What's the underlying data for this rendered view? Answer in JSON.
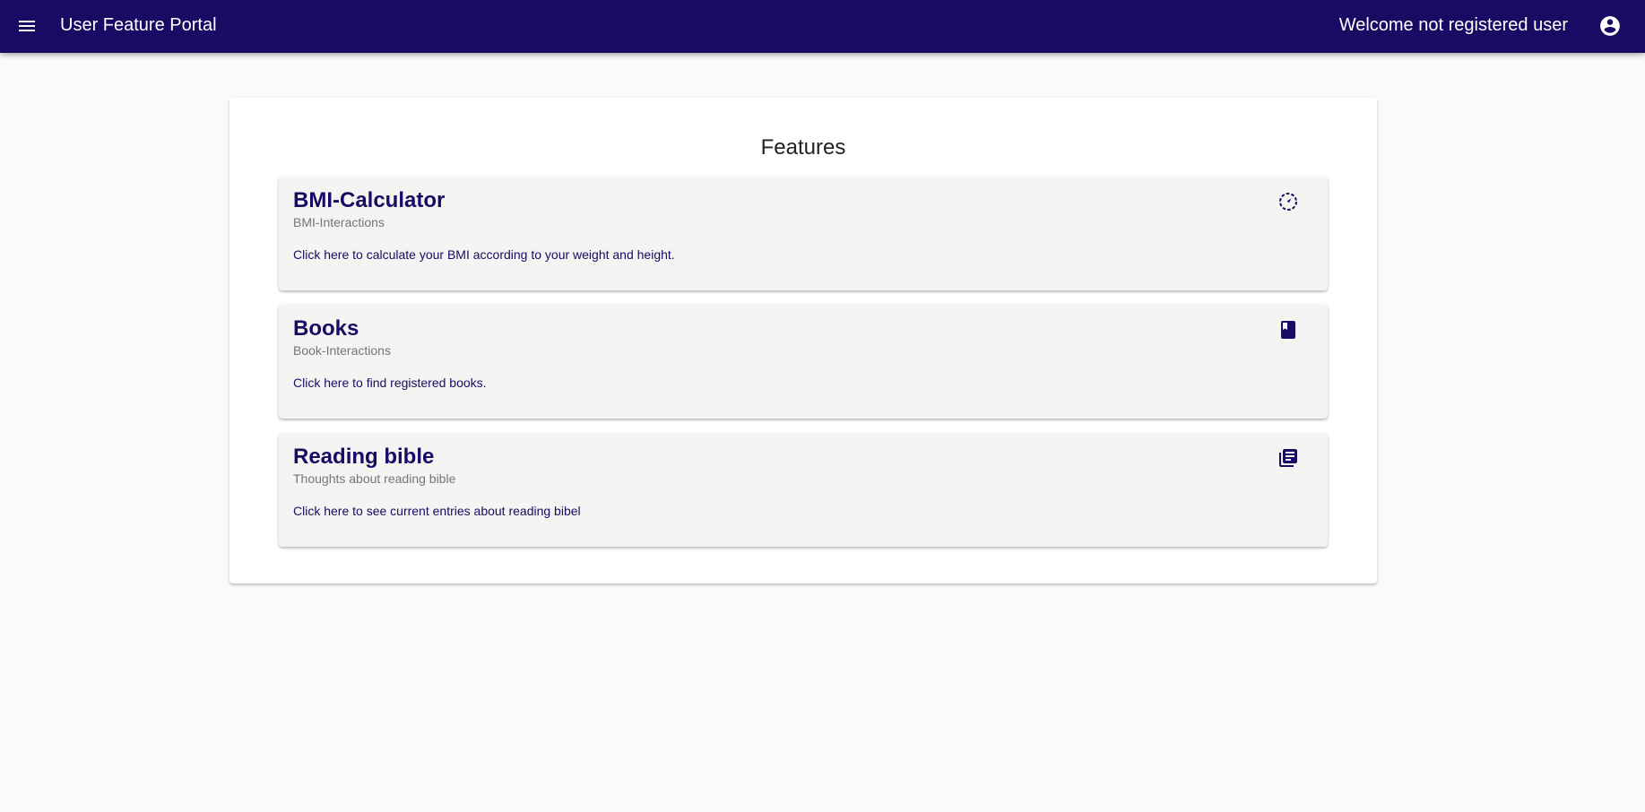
{
  "app": {
    "title": "User Feature Portal",
    "welcome": "Welcome not registered user",
    "colors": {
      "primary": "#190a63",
      "background": "#fafafa",
      "card": "#f5f4f3"
    }
  },
  "toolbar": {
    "menu_icon": "menu-icon",
    "account_icon": "account-circle-icon"
  },
  "features": {
    "title": "Features",
    "items": [
      {
        "title": "BMI-Calculator",
        "subtitle": "BMI-Interactions",
        "text": "Click here to calculate your BMI according to your weight and height.",
        "icon": "speedometer-icon"
      },
      {
        "title": "Books",
        "subtitle": "Book-Interactions",
        "text": "Click here to find registered books.",
        "icon": "book-icon"
      },
      {
        "title": "Reading bible",
        "subtitle": "Thoughts about reading bible",
        "text": "Click here to see current entries about reading bibel",
        "icon": "library-books-icon"
      }
    ]
  }
}
